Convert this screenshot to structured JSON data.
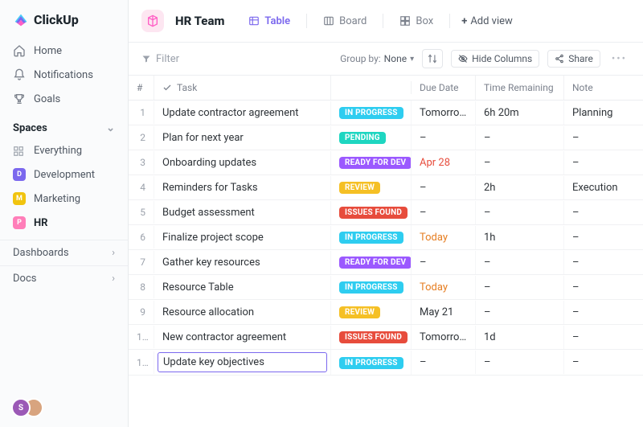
{
  "brand": {
    "name": "ClickUp"
  },
  "nav": {
    "home": "Home",
    "notifications": "Notifications",
    "goals": "Goals"
  },
  "spaces": {
    "header": "Spaces",
    "everything": "Everything",
    "items": [
      {
        "label": "Development",
        "initial": "D",
        "color": "#7b68ee"
      },
      {
        "label": "Marketing",
        "initial": "M",
        "color": "#f1c40f"
      },
      {
        "label": "HR",
        "initial": "P",
        "color": "#ff7eb9"
      }
    ]
  },
  "bottom_nav": {
    "dashboards": "Dashboards",
    "docs": "Docs"
  },
  "header": {
    "space_name": "HR Team",
    "views": {
      "table": "Table",
      "board": "Board",
      "box": "Box",
      "add": "Add view"
    }
  },
  "toolbar": {
    "filter": "Filter",
    "group_by_label": "Group by:",
    "group_by_value": "None",
    "hide_columns": "Hide Columns",
    "share": "Share"
  },
  "columns": {
    "index": "#",
    "task": "Task",
    "due": "Due Date",
    "time": "Time Remaining",
    "note": "Note"
  },
  "status_colors": {
    "IN PROGRESS": "#2ecdf0",
    "PENDING": "#1ed6c1",
    "READY FOR DEV": "#9b59ff",
    "REVIEW": "#f5c025",
    "ISSUES FOUND": "#e74c3c"
  },
  "rows": [
    {
      "name": "Update contractor agreement",
      "status": "IN PROGRESS",
      "due": "Tomorrow",
      "due_kind": "",
      "time": "6h 20m",
      "note": "Planning"
    },
    {
      "name": "Plan for next year",
      "status": "PENDING",
      "due": "–",
      "due_kind": "",
      "time": "–",
      "note": "–"
    },
    {
      "name": "Onboarding updates",
      "status": "READY FOR DEV",
      "due": "Apr 28",
      "due_kind": "soon",
      "time": "–",
      "note": "–"
    },
    {
      "name": "Reminders for Tasks",
      "status": "REVIEW",
      "due": "–",
      "due_kind": "",
      "time": "2h",
      "note": "Execution"
    },
    {
      "name": "Budget assessment",
      "status": "ISSUES FOUND",
      "due": "–",
      "due_kind": "",
      "time": "–",
      "note": "–"
    },
    {
      "name": "Finalize project scope",
      "status": "IN PROGRESS",
      "due": "Today",
      "due_kind": "today",
      "time": "1h",
      "note": "–"
    },
    {
      "name": "Gather key resources",
      "status": "READY FOR DEV",
      "due": "–",
      "due_kind": "",
      "time": "–",
      "note": "–"
    },
    {
      "name": "Resource Table",
      "status": "IN PROGRESS",
      "due": "Today",
      "due_kind": "today",
      "time": "–",
      "note": "–"
    },
    {
      "name": "Resource allocation",
      "status": "REVIEW",
      "due": "May 21",
      "due_kind": "",
      "time": "–",
      "note": "–"
    },
    {
      "name": "New contractor agreement",
      "status": "ISSUES FOUND",
      "due": "Tomorrow",
      "due_kind": "",
      "time": "1d",
      "note": "–"
    },
    {
      "name": "Update key objectives",
      "status": "IN PROGRESS",
      "due": "–",
      "due_kind": "",
      "time": "–",
      "note": "–",
      "editing": true
    }
  ],
  "avatars": {
    "initial": "S"
  }
}
